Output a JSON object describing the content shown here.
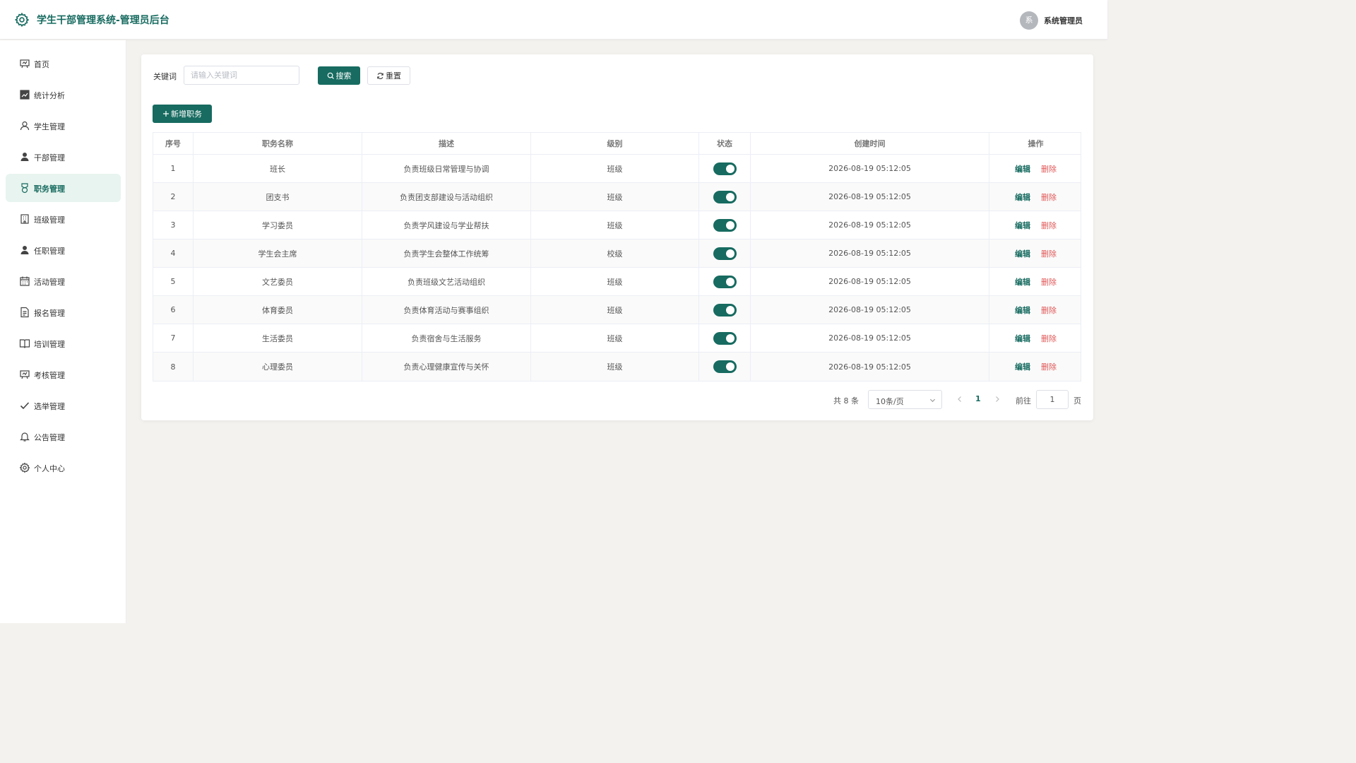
{
  "header": {
    "title": "学生干部管理系统-管理员后台",
    "avatar_text": "系",
    "user_name": "系统管理员"
  },
  "sidebar": {
    "items": [
      {
        "label": "首页",
        "icon": "presentation-icon"
      },
      {
        "label": "统计分析",
        "icon": "chart-icon"
      },
      {
        "label": "学生管理",
        "icon": "user-icon"
      },
      {
        "label": "干部管理",
        "icon": "user-filled-icon"
      },
      {
        "label": "职务管理",
        "icon": "badge-icon",
        "active": true
      },
      {
        "label": "班级管理",
        "icon": "building-icon"
      },
      {
        "label": "任职管理",
        "icon": "user-filled-icon"
      },
      {
        "label": "活动管理",
        "icon": "calendar-icon"
      },
      {
        "label": "报名管理",
        "icon": "document-icon"
      },
      {
        "label": "培训管理",
        "icon": "book-icon"
      },
      {
        "label": "考核管理",
        "icon": "presentation-icon"
      },
      {
        "label": "选举管理",
        "icon": "check-icon"
      },
      {
        "label": "公告管理",
        "icon": "bell-icon"
      },
      {
        "label": "个人中心",
        "icon": "gear-icon"
      }
    ]
  },
  "search": {
    "label": "关键词",
    "placeholder": "请输入关键词",
    "value": "",
    "search_button": "搜索",
    "reset_button": "重置",
    "add_button": "新增职务"
  },
  "table": {
    "columns": [
      "序号",
      "职务名称",
      "描述",
      "级别",
      "状态",
      "创建时间",
      "操作"
    ],
    "edit_label": "编辑",
    "delete_label": "删除",
    "rows": [
      {
        "no": "1",
        "name": "班长",
        "desc": "负责班级日常管理与协调",
        "level": "班级",
        "enabled": true,
        "created": "2026-08-19 05:12:05"
      },
      {
        "no": "2",
        "name": "团支书",
        "desc": "负责团支部建设与活动组织",
        "level": "班级",
        "enabled": true,
        "created": "2026-08-19 05:12:05"
      },
      {
        "no": "3",
        "name": "学习委员",
        "desc": "负责学风建设与学业帮扶",
        "level": "班级",
        "enabled": true,
        "created": "2026-08-19 05:12:05"
      },
      {
        "no": "4",
        "name": "学生会主席",
        "desc": "负责学生会整体工作统筹",
        "level": "校级",
        "enabled": true,
        "created": "2026-08-19 05:12:05"
      },
      {
        "no": "5",
        "name": "文艺委员",
        "desc": "负责班级文艺活动组织",
        "level": "班级",
        "enabled": true,
        "created": "2026-08-19 05:12:05"
      },
      {
        "no": "6",
        "name": "体育委员",
        "desc": "负责体育活动与赛事组织",
        "level": "班级",
        "enabled": true,
        "created": "2026-08-19 05:12:05"
      },
      {
        "no": "7",
        "name": "生活委员",
        "desc": "负责宿舍与生活服务",
        "level": "班级",
        "enabled": true,
        "created": "2026-08-19 05:12:05"
      },
      {
        "no": "8",
        "name": "心理委员",
        "desc": "负责心理健康宣传与关怀",
        "level": "班级",
        "enabled": true,
        "created": "2026-08-19 05:12:05"
      }
    ]
  },
  "pagination": {
    "total_text": "共 8 条",
    "page_size": "10条/页",
    "current_page": "1",
    "goto_label": "前往",
    "goto_value": "1",
    "page_suffix": "页"
  },
  "colors": {
    "primary": "#176b60",
    "danger": "#e05656",
    "active_bg": "#e8f4ef",
    "page_bg": "#f4f2ef"
  }
}
